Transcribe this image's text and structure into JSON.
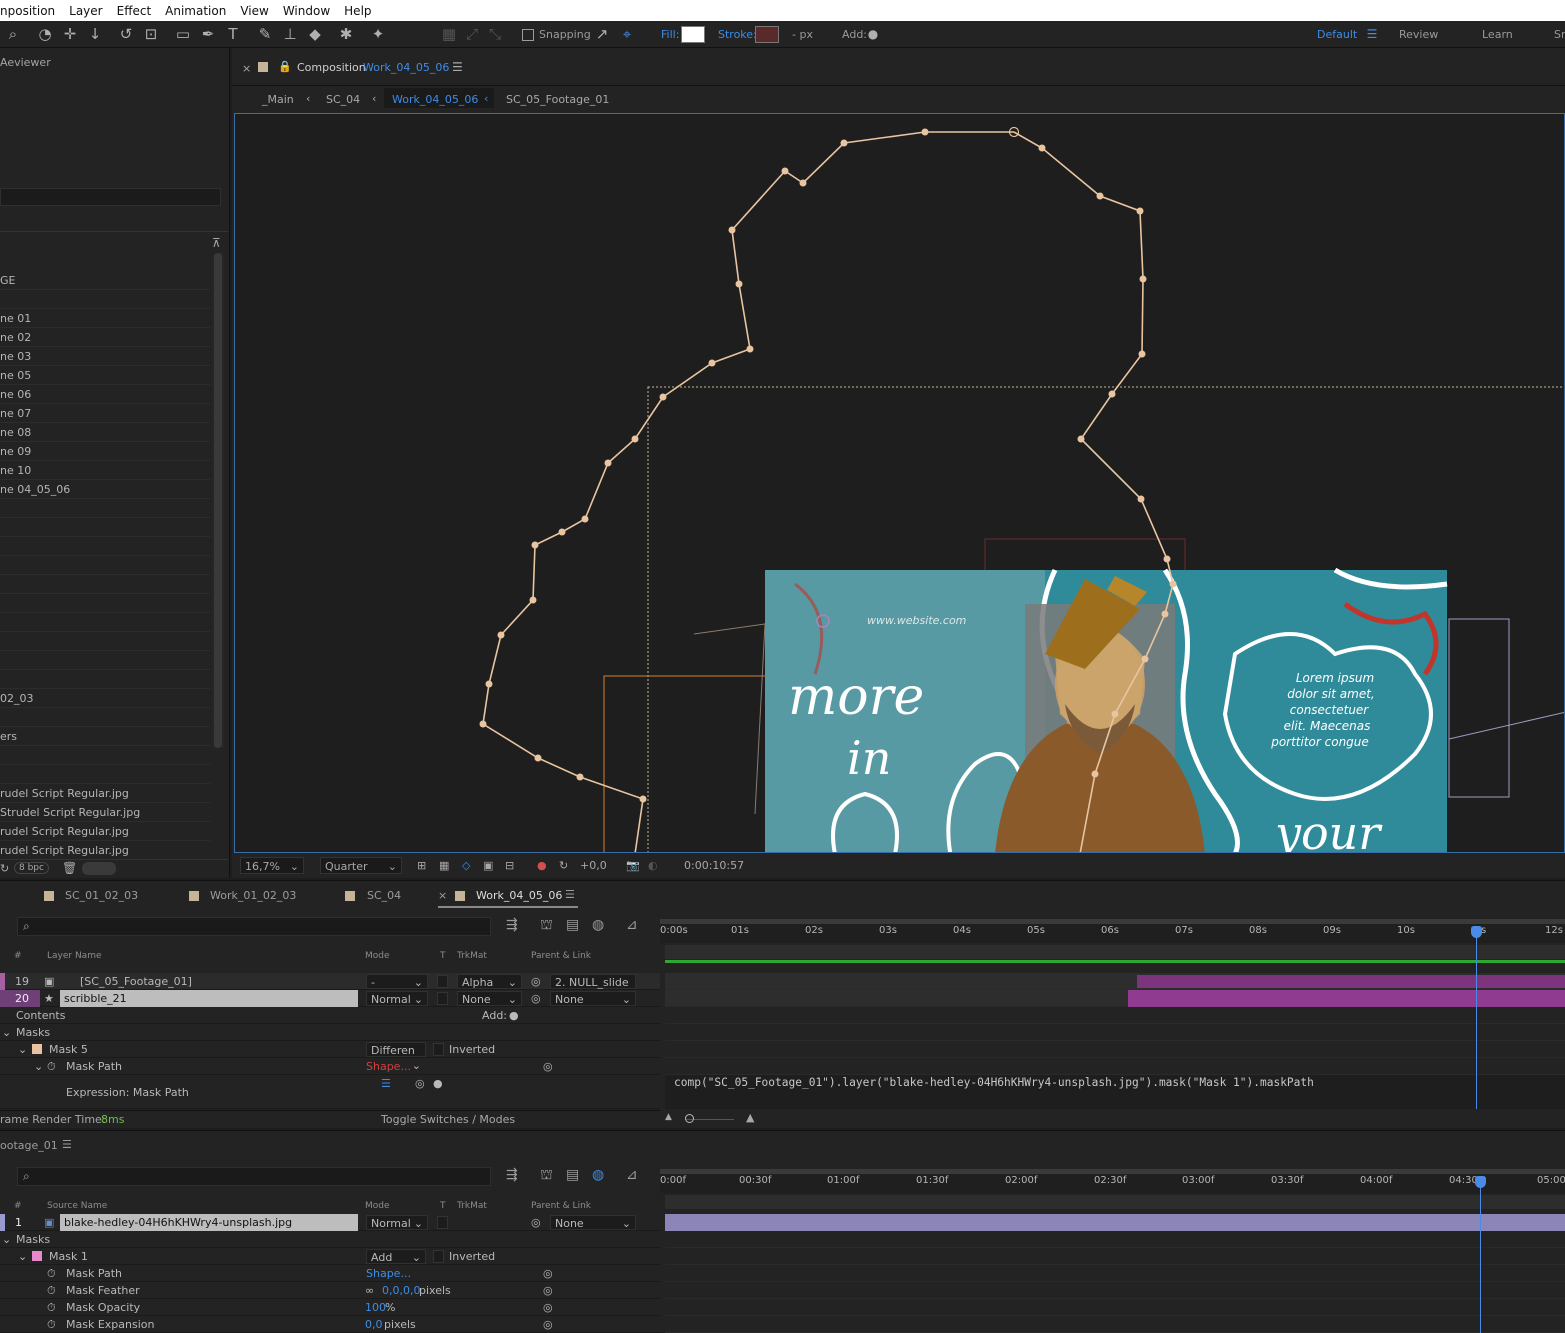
{
  "menu": [
    "nposition",
    "Layer",
    "Effect",
    "Animation",
    "View",
    "Window",
    "Help"
  ],
  "toolbar": {
    "snapping": "Snapping",
    "fill": "Fill:",
    "stroke": "Stroke:",
    "px": "- px",
    "add": "Add:",
    "workspaces": [
      "Default",
      "Review",
      "Learn",
      "Sr"
    ]
  },
  "left_panel": {
    "title": "Aeviewer",
    "items": [
      "GE",
      "ne 01",
      "ne 02",
      "ne 03",
      "ne 05",
      "ne 06",
      "ne 07",
      "ne 08",
      "ne 09",
      "ne 10",
      "ne 04_05_06",
      "02_03",
      "ers",
      "rudel Script Regular.jpg",
      "Strudel Script Regular.jpg",
      "rudel Script Regular.jpg",
      "rudel Script Regular.jpg"
    ],
    "bpc": "8 bpc"
  },
  "composition": {
    "panel_label": "Composition",
    "comp_name": "Work_04_05_06",
    "breadcrumb": [
      "_Main",
      "SC_04",
      "Work_04_05_06",
      "SC_05_Footage_01"
    ],
    "zoom": "16,7%",
    "resolution": "Quarter",
    "exposure": "+0,0",
    "timecode": "0:00:10:57",
    "art": {
      "website": "www.website.com",
      "headline1": "more",
      "headline2": "in",
      "headline3": "your",
      "body": [
        "Lorem ipsum",
        "dolor sit amet,",
        "consectetuer",
        "elit. Maecenas",
        "porttitor congue"
      ]
    }
  },
  "timeline1": {
    "tabs": [
      "SC_01_02_03",
      "Work_01_02_03",
      "SC_04",
      "Work_04_05_06"
    ],
    "headers": {
      "num": "#",
      "layer_name": "Layer Name",
      "mode": "Mode",
      "t": "T",
      "trkmat": "TrkMat",
      "parent": "Parent & Link"
    },
    "ruler": [
      "0:00s",
      "01s",
      "02s",
      "03s",
      "04s",
      "05s",
      "06s",
      "07s",
      "08s",
      "09s",
      "10s",
      "s",
      "12s"
    ],
    "layers": [
      {
        "num": "19",
        "name": "[SC_05_Footage_01]",
        "mode": "-",
        "trkmat": "Alpha",
        "parent": "2. NULL_slide"
      },
      {
        "num": "20",
        "name": "scribble_21",
        "mode": "Normal",
        "trkmat": "None",
        "parent": "None"
      }
    ],
    "props": {
      "contents": "Contents",
      "add": "Add:",
      "masks": "Masks",
      "mask5": "Mask 5",
      "mask5_mode": "Differen",
      "inverted": "Inverted",
      "mask_path": "Mask Path",
      "shape": "Shape...",
      "expr_label": "Expression: Mask Path"
    },
    "expression": "comp(\"SC_05_Footage_01\").layer(\"blake-hedley-04H6hKHWry4-unsplash.jpg\").mask(\"Mask 1\").maskPath",
    "render_label": "rame Render Time:",
    "render_value": "8ms",
    "toggle": "Toggle Switches / Modes"
  },
  "timeline2": {
    "title": "ootage_01",
    "headers": {
      "num": "#",
      "source_name": "Source Name",
      "mode": "Mode",
      "t": "T",
      "trkmat": "TrkMat",
      "parent": "Parent & Link"
    },
    "ruler": [
      "0:00f",
      "00:30f",
      "01:00f",
      "01:30f",
      "02:00f",
      "02:30f",
      "03:00f",
      "03:30f",
      "04:00f",
      "04:30",
      "05:00"
    ],
    "layer": {
      "num": "1",
      "name": "blake-hedley-04H6hKHWry4-unsplash.jpg",
      "mode": "Normal",
      "parent": "None"
    },
    "props": {
      "masks": "Masks",
      "mask1": "Mask 1",
      "mask1_mode": "Add",
      "inverted": "Inverted",
      "mask_path": "Mask Path",
      "shape": "Shape...",
      "mask_feather": "Mask Feather",
      "feather_val": "0,0,0,0",
      "feather_unit": "pixels",
      "mask_opacity": "Mask Opacity",
      "opacity_val": "100",
      "opacity_unit": "%",
      "mask_expansion": "Mask Expansion",
      "expansion_val": "0,0",
      "expansion_unit": "pixels"
    }
  },
  "colors": {
    "accent": "#3e8ce6",
    "mask_path": "#e8c5a0",
    "art_teal": "#2f8a99",
    "layer_bar": "#8f3b8f"
  }
}
